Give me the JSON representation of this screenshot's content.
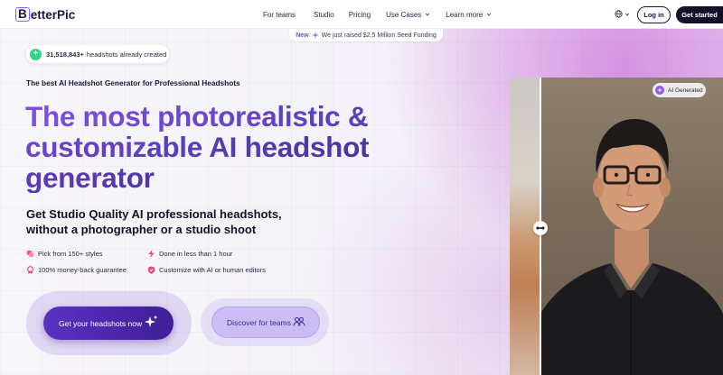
{
  "nav": {
    "logo": "BetterPic",
    "links": [
      {
        "label": "For teams",
        "dropdown": false
      },
      {
        "label": "Studio",
        "dropdown": false
      },
      {
        "label": "Pricing",
        "dropdown": false
      },
      {
        "label": "Use Cases",
        "dropdown": true
      },
      {
        "label": "Learn more",
        "dropdown": true
      }
    ],
    "login": "Log in",
    "get_started": "Get started"
  },
  "announcement": {
    "badge": "New",
    "text": "We just raised $2.5 Million Seed Funding"
  },
  "counter": {
    "count": "31,518,843+",
    "text": "headshots already created"
  },
  "tagline": "The best AI Headshot Generator for Professional Headshots",
  "headline": {
    "line1": "The most photorealistic &",
    "line2": "customizable AI headshot",
    "line3": "generator"
  },
  "subheadline": {
    "line1": "Get Studio Quality AI professional headshots,",
    "line2": "without a photographer or a studio shoot"
  },
  "features": [
    {
      "icon": "layers-icon",
      "label": "Pick from 150+ styles"
    },
    {
      "icon": "lightning-icon",
      "label": "Done in less than 1 hour"
    },
    {
      "icon": "medal-icon",
      "label": "100% money-back guarantee"
    },
    {
      "icon": "shield-icon",
      "label": "Customize with AI or human editors"
    }
  ],
  "cta": {
    "primary": "Get your headshots now",
    "secondary": "Discover for teams"
  },
  "photo": {
    "badge": "AI Generated"
  },
  "colors": {
    "brand_purple": "#5a31c2",
    "dark": "#14102a",
    "success_green": "#37d08a"
  }
}
